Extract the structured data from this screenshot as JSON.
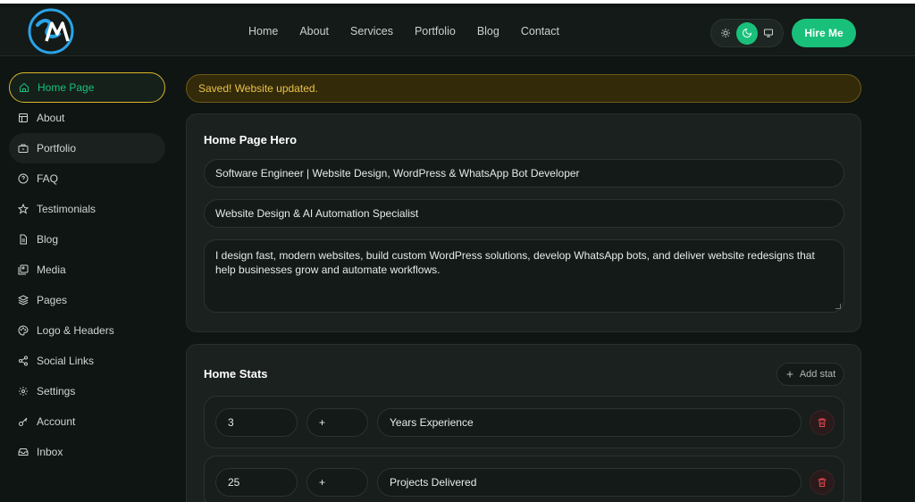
{
  "header": {
    "logo_text": "SM",
    "nav": [
      "Home",
      "About",
      "Services",
      "Portfolio",
      "Blog",
      "Contact"
    ],
    "theme_options": [
      "sun-icon",
      "moon-icon",
      "monitor-icon"
    ],
    "theme_selected": "moon-icon",
    "hire_label": "Hire Me"
  },
  "sidebar": {
    "items": [
      {
        "label": "Home Page",
        "icon": "home-icon"
      },
      {
        "label": "About",
        "icon": "layout-icon"
      },
      {
        "label": "Portfolio",
        "icon": "briefcase-icon"
      },
      {
        "label": "FAQ",
        "icon": "help-circle-icon"
      },
      {
        "label": "Testimonials",
        "icon": "star-icon"
      },
      {
        "label": "Blog",
        "icon": "document-icon"
      },
      {
        "label": "Media",
        "icon": "image-icon"
      },
      {
        "label": "Pages",
        "icon": "layers-icon"
      },
      {
        "label": "Logo & Headers",
        "icon": "palette-icon"
      },
      {
        "label": "Social Links",
        "icon": "share-icon"
      },
      {
        "label": "Settings",
        "icon": "gear-icon"
      },
      {
        "label": "Account",
        "icon": "key-icon"
      },
      {
        "label": "Inbox",
        "icon": "inbox-icon"
      }
    ],
    "active": "Home Page"
  },
  "alert": {
    "message": "Saved! Website updated."
  },
  "hero": {
    "title": "Home Page Hero",
    "headline": "Software Engineer | Website Design, WordPress & WhatsApp Bot Developer",
    "subheadline": "Website Design & AI Automation Specialist",
    "description": "I design fast, modern websites, build custom WordPress solutions, develop WhatsApp bots, and deliver website redesigns that help businesses grow and automate workflows."
  },
  "stats": {
    "title": "Home Stats",
    "add_label": "Add stat",
    "rows": [
      {
        "value": "3",
        "suffix": "+",
        "label": "Years Experience"
      },
      {
        "value": "25",
        "suffix": "+",
        "label": "Projects Delivered"
      }
    ]
  },
  "colors": {
    "accent": "#19c07a",
    "active_border": "#d9b52c",
    "alert_text": "#eac248",
    "danger": "#e5484d"
  }
}
